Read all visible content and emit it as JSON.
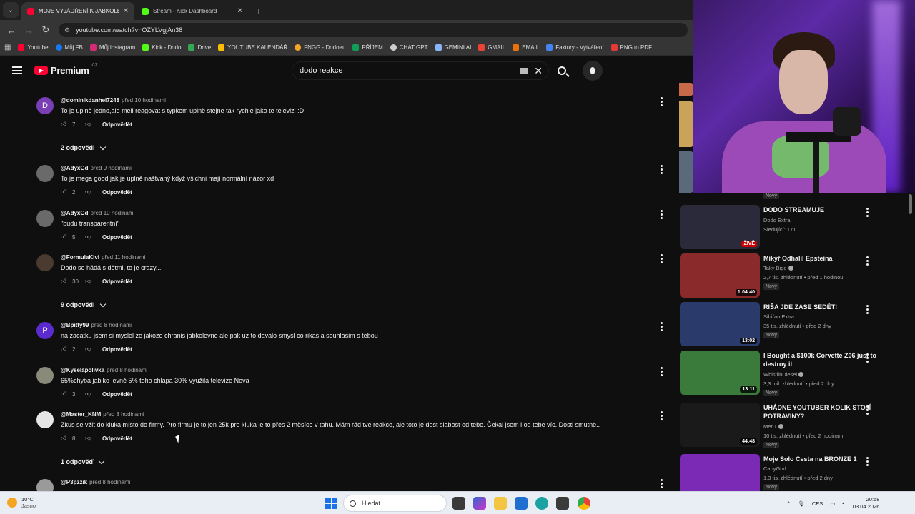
{
  "browser": {
    "tabs": [
      {
        "title": "MOJE VYJÁDŘENÍ K JABKOLEVNE",
        "active": true,
        "favicon_color": "#ff0033"
      },
      {
        "title": "Stream - Kick Dashboard",
        "active": false,
        "favicon_color": "#53fc18"
      }
    ],
    "new_tab": "+",
    "url": "youtube.com/watch?v=OZYLVgjAn38",
    "bookmarks": [
      {
        "label": "Youtube",
        "color": "#ff0033"
      },
      {
        "label": "Můj FB",
        "color": "#1877f2"
      },
      {
        "label": "Můj instagram",
        "color": "#d62976"
      },
      {
        "label": "Kick - Dodo",
        "color": "#53fc18"
      },
      {
        "label": "Drive",
        "color": "#34a853"
      },
      {
        "label": "YOUTUBE KALENDÁŘ",
        "color": "#fbbc04"
      },
      {
        "label": "FNGG - Dodoeu",
        "color": "#f5a623"
      },
      {
        "label": "PŘÍJEM",
        "color": "#0f9d58"
      },
      {
        "label": "CHAT GPT",
        "color": "#cccccc"
      },
      {
        "label": "GEMINI AI",
        "color": "#8ab4f8"
      },
      {
        "label": "GMAIL",
        "color": "#ea4335"
      },
      {
        "label": "EMAIL",
        "color": "#e8710a"
      },
      {
        "label": "Faktury - Vytváření",
        "color": "#4285f4"
      },
      {
        "label": "PNG to PDF",
        "color": "#e53935"
      }
    ]
  },
  "youtube": {
    "logo_text": "Premium",
    "logo_region": "CZ",
    "search_value": "dodo reakce"
  },
  "comments": [
    {
      "user": "@dominikdanhel7248",
      "time": "před 10 hodinami",
      "text": "To je uplně jedno,ale meli reagovat s typkem uplně stejne tak rychle jako te televizi :D",
      "likes": "7",
      "reply_label": "Odpovědět",
      "avatar_letter": "D",
      "avatar_color": "#7b3fb5",
      "replies": "2 odpovědi"
    },
    {
      "user": "@AdyxGd",
      "time": "před 9 hodinami",
      "text": "To je mega good jak je uplně naštvaný když všichni mají normální názor xd",
      "likes": "2",
      "reply_label": "Odpovědět",
      "avatar_letter": "",
      "avatar_color": "#6a6a6a",
      "replies": ""
    },
    {
      "user": "@AdyxGd",
      "time": "před 10 hodinami",
      "text": "\"budu transparentní\"",
      "likes": "5",
      "reply_label": "Odpovědět",
      "avatar_letter": "",
      "avatar_color": "#6a6a6a",
      "replies": ""
    },
    {
      "user": "@FormulaKivi",
      "time": "před 11 hodinami",
      "text": "Dodo se hádá s dětmi, to je crazy...",
      "likes": "30",
      "reply_label": "Odpovědět",
      "avatar_letter": "",
      "avatar_color": "#4a3a30",
      "replies": "9 odpovědi"
    },
    {
      "user": "@Bpitty99",
      "time": "před 8 hodinami",
      "text": "na zacatku jsem si myslel ze jakoze chranis jabkolevne ale pak uz to davalo smysl co rikas a souhlasim s tebou",
      "likes": "2",
      "reply_label": "Odpovědět",
      "avatar_letter": "P",
      "avatar_color": "#5b2bd0",
      "replies": ""
    },
    {
      "user": "@Kyselápolívka",
      "time": "před 8 hodinami",
      "text": "65%chyba jablko levně 5% toho chlapa 30% využila televize Nova",
      "likes": "3",
      "reply_label": "Odpovědět",
      "avatar_letter": "",
      "avatar_color": "#8a8a7a",
      "replies": ""
    },
    {
      "user": "@Master_KNM",
      "time": "před 8 hodinami",
      "text": "Zkus se vžít do kluka místo do firmy. Pro firmu je to jen 25k pro kluka je to přes 2 měsíce v tahu. Mám rád tvé reakce, ale toto je dost slabost od tebe. Čekal jsem i od tebe víc. Dosti smutné..",
      "likes": "8",
      "reply_label": "Odpovědět",
      "avatar_letter": "",
      "avatar_color": "#e6e6e6",
      "replies": "1 odpověď"
    },
    {
      "user": "@P3pzzik",
      "time": "před 8 hodinami",
      "text": "",
      "likes": "",
      "reply_label": "",
      "avatar_letter": "",
      "avatar_color": "#9a9a9a",
      "replies": ""
    }
  ],
  "sidebar": {
    "top_new_badge": "Nový",
    "videos": [
      {
        "title": "DODO STREAMUJE",
        "channel": "Dodo Extra",
        "meta": "Sledující: 171",
        "badge": "",
        "duration": "",
        "live": "ŽIVĚ",
        "thumb_color": "#2a2a3a",
        "verified": false
      },
      {
        "title": "Mikýř Odhalil Epsteina",
        "channel": "Taky Bige",
        "meta": "2,7 tis. zhlédnutí • před 1 hodinou",
        "badge": "Nový",
        "duration": "1:04:40",
        "live": "",
        "thumb_color": "#8a2a2a",
        "verified": true
      },
      {
        "title": "RIŠA JDE ZASE SEDĚT!",
        "channel": "Sibiřan Extra",
        "meta": "35 tis. zhlédnutí • před 2 dny",
        "badge": "Nový",
        "duration": "13:02",
        "live": "",
        "thumb_color": "#2a3a6a",
        "verified": false
      },
      {
        "title": "I Bought a $100k Corvette Z06 just to destroy it",
        "channel": "WhistlinDiesel",
        "meta": "3,3 mil. zhlédnutí • před 2 dny",
        "badge": "Nový",
        "duration": "13:11",
        "live": "",
        "thumb_color": "#3a7a3a",
        "verified": true
      },
      {
        "title": "UHÁDNE YOUTUBER KOLIK STOJÍ POTRAVINY?",
        "channel": "MenT",
        "meta": "10 tis. zhlédnutí • před 2 hodinami",
        "badge": "Nový",
        "duration": "44:48",
        "live": "",
        "thumb_color": "#1a1a1a",
        "verified": true
      },
      {
        "title": "Moje Solo Cesta na BRONZE 1",
        "channel": "CapyGod",
        "meta": "1,3 tis. zhlédnutí • před 2 dny",
        "badge": "Nový",
        "duration": "",
        "live": "",
        "thumb_color": "#7a2ab5",
        "verified": false
      }
    ]
  },
  "taskbar": {
    "temperature": "10°C",
    "weather": "Jasno",
    "search_placeholder": "Hledat",
    "language": "CES",
    "time": "20:58",
    "date": "03.04.2026"
  }
}
